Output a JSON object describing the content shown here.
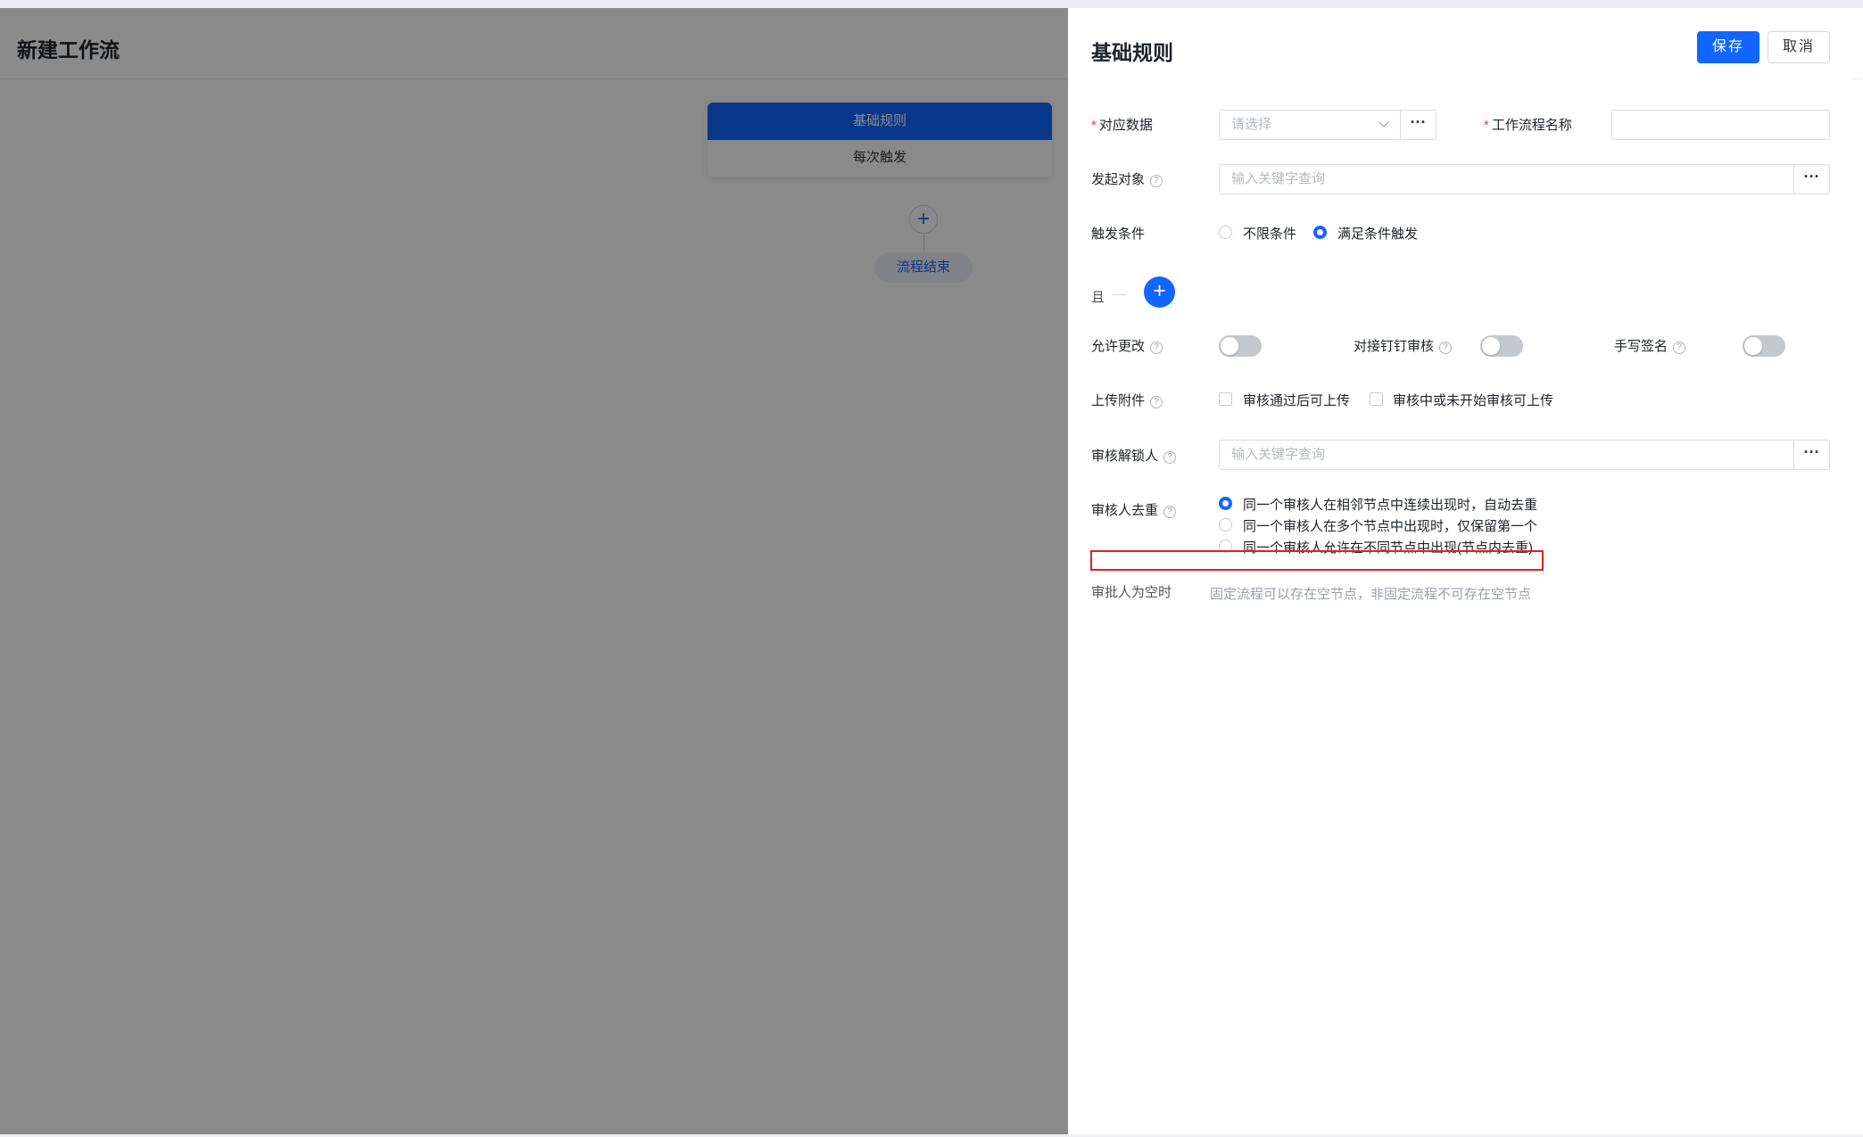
{
  "page": {
    "title": "新建工作流"
  },
  "flow": {
    "card_head": "基础规则",
    "card_body": "每次触发",
    "add_symbol": "+",
    "end_label": "流程结束"
  },
  "drawer": {
    "title": "基础规则",
    "save_label": "保存",
    "cancel_label": "取消",
    "dots": "···",
    "fields": {
      "data_source": {
        "label": "对应数据",
        "required_mark": "*",
        "placeholder": "请选择"
      },
      "workflow_name": {
        "label": "工作流程名称",
        "required_mark": "*",
        "value": ""
      },
      "initiator": {
        "label": "发起对象",
        "placeholder": "输入关键字查询"
      },
      "trigger": {
        "label": "触发条件",
        "options": [
          "不限条件",
          "满足条件触发"
        ],
        "selected": "满足条件触发"
      },
      "and": {
        "label": "且",
        "add_symbol": "+"
      },
      "allow_edit": {
        "label": "允许更改",
        "on": false
      },
      "dingtalk": {
        "label": "对接钉钉审核",
        "on": false
      },
      "signature": {
        "label": "手写签名",
        "on": false
      },
      "upload": {
        "label": "上传附件",
        "options": [
          "审核通过后可上传",
          "审核中或未开始审核可上传"
        ]
      },
      "unlocker": {
        "label": "审核解锁人",
        "placeholder": "输入关键字查询"
      },
      "dedupe": {
        "label": "审核人去重",
        "options": [
          "同一个审核人在相邻节点中连续出现时，自动去重",
          "同一个审核人在多个节点中出现时，仅保留第一个",
          "同一个审核人允许在不同节点中出现(节点内去重)"
        ],
        "selected": 0
      },
      "empty_approver": {
        "label": "审批人为空时",
        "hint": "固定流程可以存在空节点，非固定流程不可存在空节点"
      }
    },
    "help_symbol": "?"
  },
  "colors": {
    "primary": "#1166ff",
    "required": "#e8403b",
    "highlight_box": "#e02020"
  }
}
